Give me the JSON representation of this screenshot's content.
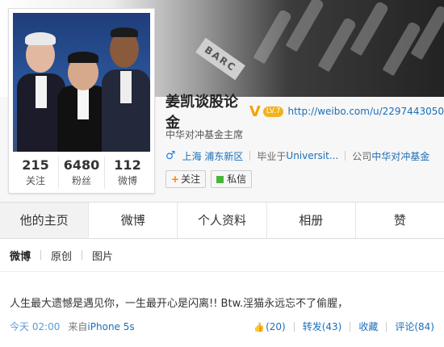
{
  "cover": {
    "sign_text": "BARC"
  },
  "profile": {
    "name": "姜凯谈股论金",
    "verified_mark": "V",
    "level": "LV.7",
    "weibo_url": "http://weibo.com/u/2297443050",
    "title": "中华对冲基金主席",
    "location": "上海 浦东新区",
    "education_label": "毕业于",
    "education": "Universit...",
    "company_label": "公司",
    "company": "中华对冲基金",
    "follow_label": "关注",
    "message_label": "私信"
  },
  "stats": [
    {
      "num": "215",
      "label": "关注"
    },
    {
      "num": "6480",
      "label": "粉丝"
    },
    {
      "num": "112",
      "label": "微博"
    }
  ],
  "tabs": [
    "他的主页",
    "微博",
    "个人资料",
    "相册",
    "赞"
  ],
  "subtabs": [
    "微博",
    "原创",
    "图片"
  ],
  "post": {
    "text": "人生最大遗憾是遇见你，一生最开心是闪离!! Btw.淫猫永远忘不了偷腥，",
    "time": "今天 02:00",
    "source_label": "来自",
    "source": "iPhone 5s",
    "like": "(20)",
    "repost": "转发(43)",
    "favorite": "收藏",
    "comment": "评论(84)"
  },
  "colors": {
    "link": "#1a6fb7",
    "accent_orange": "#ff8200",
    "verified_gold": "#f0a400"
  }
}
